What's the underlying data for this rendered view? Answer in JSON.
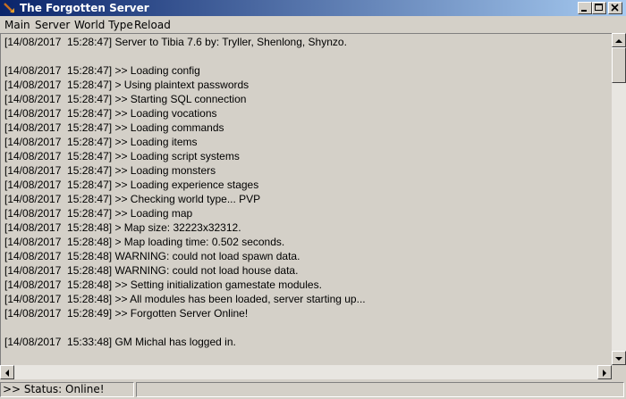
{
  "window": {
    "title": "The Forgotten Server"
  },
  "menu": {
    "items": [
      "Main",
      "Server",
      "World Type",
      "Reload"
    ]
  },
  "log": {
    "lines": [
      "[14/08/2017  15:28:47] Server to Tibia 7.6 by: Tryller, Shenlong, Shynzo.",
      "",
      "[14/08/2017  15:28:47] >> Loading config",
      "[14/08/2017  15:28:47] > Using plaintext passwords",
      "[14/08/2017  15:28:47] >> Starting SQL connection",
      "[14/08/2017  15:28:47] >> Loading vocations",
      "[14/08/2017  15:28:47] >> Loading commands",
      "[14/08/2017  15:28:47] >> Loading items",
      "[14/08/2017  15:28:47] >> Loading script systems",
      "[14/08/2017  15:28:47] >> Loading monsters",
      "[14/08/2017  15:28:47] >> Loading experience stages",
      "[14/08/2017  15:28:47] >> Checking world type... PVP",
      "[14/08/2017  15:28:47] >> Loading map",
      "[14/08/2017  15:28:48] > Map size: 32223x32312.",
      "[14/08/2017  15:28:48] > Map loading time: 0.502 seconds.",
      "[14/08/2017  15:28:48] WARNING: could not load spawn data.",
      "[14/08/2017  15:28:48] WARNING: could not load house data.",
      "[14/08/2017  15:28:48] >> Setting initialization gamestate modules.",
      "[14/08/2017  15:28:48] >> All modules has been loaded, server starting up...",
      "[14/08/2017  15:28:49] >> Forgotten Server Online!",
      "",
      "[14/08/2017  15:33:48] GM Michal has logged in."
    ]
  },
  "status": {
    "text": ">> Status: Online!",
    "secondary": ""
  },
  "icons": {
    "app": "arrow-icon",
    "minimize": "minimize-icon",
    "maximize": "maximize-icon",
    "close": "close-icon"
  }
}
